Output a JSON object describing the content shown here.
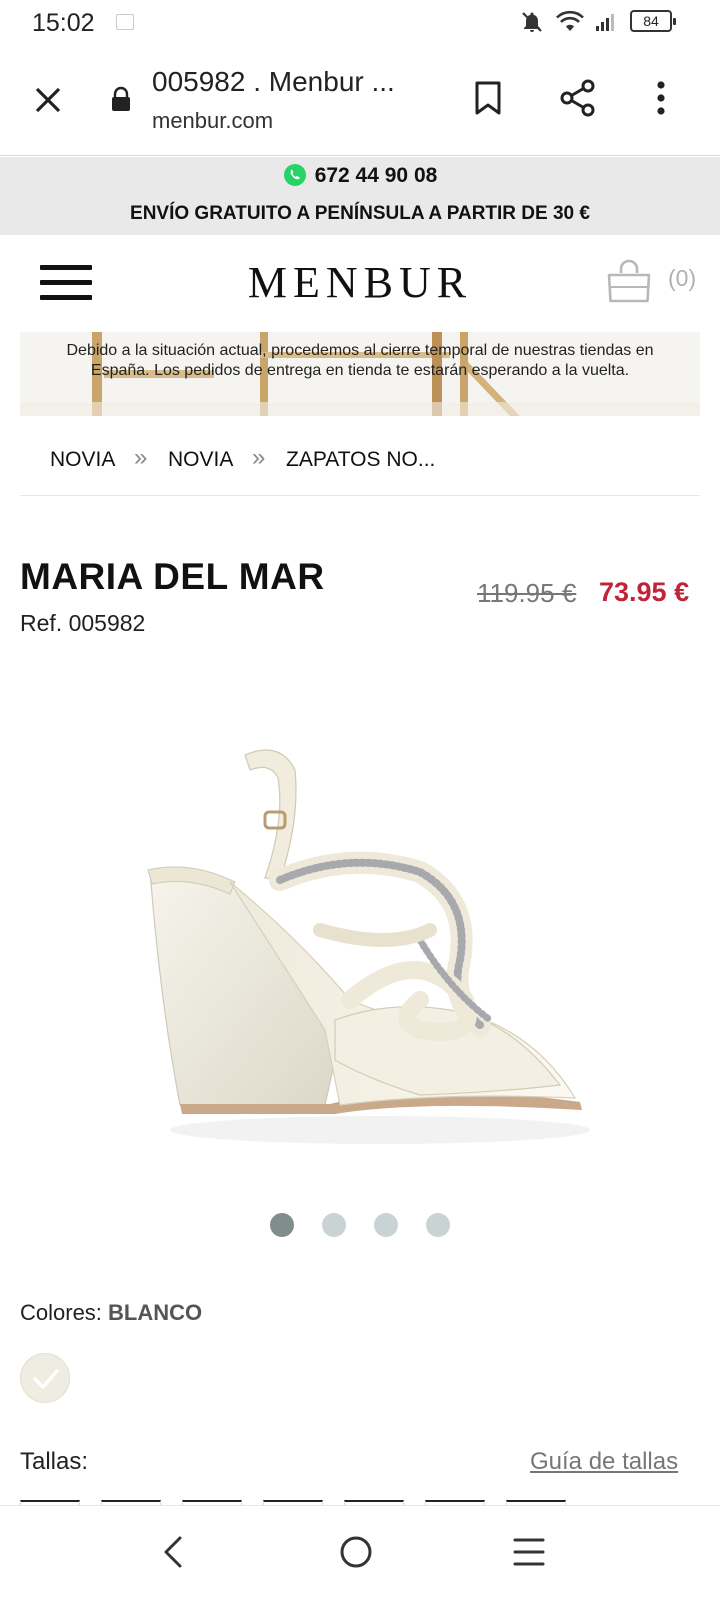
{
  "status_bar": {
    "time": "15:02",
    "battery": "84",
    "icons": [
      "image-icon",
      "notifications-off-icon",
      "wifi-icon",
      "signal-icon",
      "battery-icon"
    ]
  },
  "browser": {
    "title": "005982 . Menbur ...",
    "url": "menbur.com",
    "icons": [
      "close-icon",
      "lock-icon",
      "bookmark-icon",
      "share-icon",
      "more-vert-icon"
    ]
  },
  "announcement": {
    "phone": "672 44 90 08",
    "shipping": "ENVÍO GRATUITO A PENÍNSULA A PARTIR DE 30 €",
    "phone_icon": "whatsapp-icon",
    "accent": "#25d366"
  },
  "header": {
    "logo": "MENBUR",
    "cart_count": "(0)"
  },
  "notice": {
    "text": "Debido a la situación actual, procedemos al cierre temporal de nuestras tiendas en España. Los pedidos de entrega en tienda te estarán esperando a la vuelta."
  },
  "breadcrumb": {
    "items": [
      "NOVIA",
      "NOVIA",
      "ZAPATOS NO..."
    ],
    "separator": "»"
  },
  "product": {
    "name": "MARIA DEL MAR",
    "ref": "Ref. 005982",
    "price_old": "119.95 €",
    "price_new": "73.95 €",
    "price_color": "#c0243b",
    "image_count": 4,
    "active_image": 1
  },
  "colors": {
    "label": "Colores:",
    "value": "BLANCO"
  },
  "sizes": {
    "label": "Tallas:",
    "guide_link": "Guía de tallas"
  },
  "nav": {
    "icons": [
      "back-icon",
      "home-icon",
      "recents-icon"
    ]
  }
}
